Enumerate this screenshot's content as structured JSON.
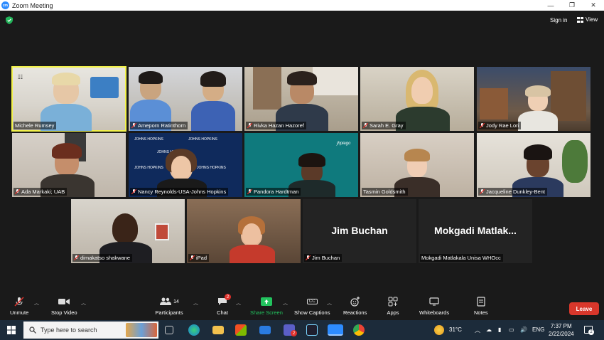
{
  "window": {
    "title": "Zoom Meeting",
    "minimize": "—",
    "restore": "❐",
    "close": "✕"
  },
  "header": {
    "sign_in": "Sign in",
    "view": "View"
  },
  "participants_tiles": [
    {
      "name": "Michele Rumsey",
      "muted": false,
      "speaking": true
    },
    {
      "name": "Ameporn Ratinthorn",
      "muted": true
    },
    {
      "name": "Rivka Hazan Hazoref",
      "muted": true
    },
    {
      "name": "Sarah E. Gray",
      "muted": true
    },
    {
      "name": "Jody Rae Lori",
      "muted": true
    },
    {
      "name": "Ada Markaki; UAB",
      "muted": true
    },
    {
      "name": "Nancy Reynolds-USA-Johns Hopkins",
      "muted": true
    },
    {
      "name": "Pandora Hardtman",
      "muted": true
    },
    {
      "name": "Tasmin Goldsmith",
      "muted": false
    },
    {
      "name": "Jacqueline Dunkley-Bent",
      "muted": true
    },
    {
      "name": "dimakatso shakwane",
      "muted": true
    },
    {
      "name": "iPad",
      "muted": true
    },
    {
      "name": "Jim Buchan",
      "muted": true,
      "display": "Jim Buchan"
    },
    {
      "name": "Mokgadi Matlakala Unisa WHOcc",
      "muted": false,
      "display": "Mokgadi  Matlak..."
    }
  ],
  "tile_texts": {
    "jhpiego": "jhpiego",
    "johns_hopkins": "JOHNS HOPKINS"
  },
  "toolbar": {
    "unmute": "Unmute",
    "stop_video": "Stop Video",
    "participants": "Participants",
    "participants_count": "14",
    "chat": "Chat",
    "chat_badge": "2",
    "share_screen": "Share Screen",
    "show_captions": "Show Captions",
    "cc": "CC",
    "reactions": "Reactions",
    "apps": "Apps",
    "whiteboards": "Whiteboards",
    "notes": "Notes",
    "leave": "Leave"
  },
  "taskbar": {
    "search_placeholder": "Type here to search",
    "teams_badge": "2",
    "weather": "31°C",
    "language": "ENG",
    "time": "7:37 PM",
    "date": "2/22/2024",
    "notifications_badge": "2"
  },
  "colors": {
    "accent": "#2d8cff",
    "leave": "#d9372b",
    "active_speaker": "#f2f24a",
    "share": "#22c35e"
  }
}
